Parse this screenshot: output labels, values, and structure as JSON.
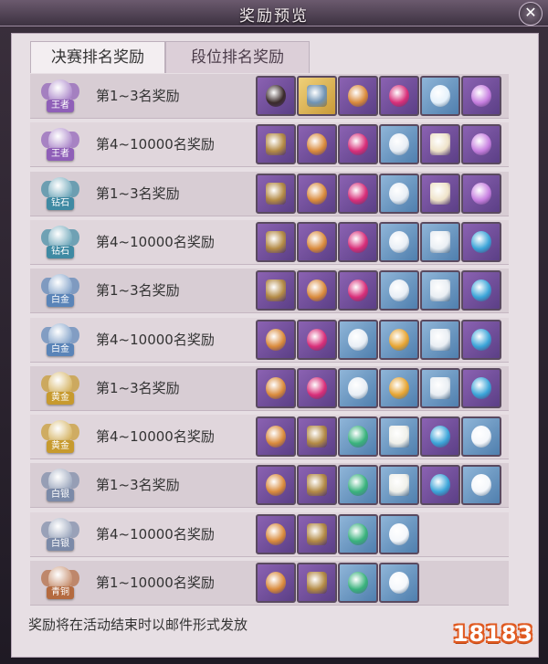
{
  "window": {
    "title": "奖励预览"
  },
  "tabs": [
    {
      "label": "决赛排名奖励",
      "active": true
    },
    {
      "label": "段位排名奖励",
      "active": false
    }
  ],
  "rows": [
    {
      "tier": "王者",
      "tier_color": "#8f5fb8",
      "label": "第1~3名奖励",
      "items": [
        "armor-portrait",
        "blue-chest",
        "gold-pouch",
        "pink-apple",
        "blue-crystal",
        "purple-mask"
      ]
    },
    {
      "tier": "王者",
      "tier_color": "#8f5fb8",
      "label": "第4~10000名奖励",
      "items": [
        "gold-chest",
        "gold-pouch",
        "pink-apple",
        "silver-crystal",
        "scroll",
        "purple-mask"
      ]
    },
    {
      "tier": "钻石",
      "tier_color": "#3f8aa3",
      "label": "第1~3名奖励",
      "items": [
        "gold-chest",
        "gold-pouch",
        "pink-apple",
        "silver-crystal",
        "scroll",
        "purple-mask"
      ]
    },
    {
      "tier": "钻石",
      "tier_color": "#3f8aa3",
      "label": "第4~10000名奖励",
      "items": [
        "gold-chest",
        "gold-pouch",
        "pink-apple",
        "silver-crystal",
        "blue-scroll",
        "blue-mask"
      ]
    },
    {
      "tier": "白金",
      "tier_color": "#5a84b8",
      "label": "第1~3名奖励",
      "items": [
        "gold-chest",
        "gold-pouch",
        "pink-apple",
        "silver-crystal",
        "blue-scroll",
        "blue-mask"
      ]
    },
    {
      "tier": "白金",
      "tier_color": "#5a84b8",
      "label": "第4~10000名奖励",
      "items": [
        "gold-pouch",
        "pink-apple",
        "silver-crystal",
        "gold-shard",
        "blue-scroll",
        "blue-mask"
      ]
    },
    {
      "tier": "黄金",
      "tier_color": "#c79a2e",
      "label": "第1~3名奖励",
      "items": [
        "gold-pouch",
        "pink-apple",
        "silver-crystal",
        "gold-shard",
        "blue-scroll",
        "blue-mask"
      ]
    },
    {
      "tier": "黄金",
      "tier_color": "#c79a2e",
      "label": "第4~10000名奖励",
      "items": [
        "gold-pouch",
        "gold-chest",
        "green-gem",
        "scroll-plain",
        "blue-mask",
        "white-crystal"
      ]
    },
    {
      "tier": "白银",
      "tier_color": "#7b8aa8",
      "label": "第1~3名奖励",
      "items": [
        "gold-pouch",
        "gold-chest",
        "green-gem",
        "scroll-plain",
        "blue-mask",
        "white-crystal"
      ]
    },
    {
      "tier": "白银",
      "tier_color": "#7b8aa8",
      "label": "第4~10000名奖励",
      "items": [
        "gold-pouch",
        "gold-chest",
        "green-gem",
        "white-crystal"
      ]
    },
    {
      "tier": "青铜",
      "tier_color": "#b46a3f",
      "label": "第1~10000名奖励",
      "items": [
        "gold-pouch",
        "gold-chest",
        "green-gem",
        "white-crystal"
      ]
    }
  ],
  "footer": {
    "text": "奖励将在活动结束时以邮件形式发放"
  },
  "watermark": {
    "text": "18183"
  },
  "item_styles": {
    "armor-portrait": {
      "frame": "r-purple",
      "color": "#3a2a2a"
    },
    "blue-chest": {
      "frame": "r-gold",
      "color": "#6f93b5"
    },
    "gold-pouch": {
      "frame": "r-purple",
      "color": "#d98a3b"
    },
    "pink-apple": {
      "frame": "r-purple",
      "color": "#d82e79"
    },
    "blue-crystal": {
      "frame": "r-blue",
      "color": "#e5f1fb"
    },
    "purple-mask": {
      "frame": "r-purple",
      "color": "#c77fe0"
    },
    "gold-chest": {
      "frame": "r-purple",
      "color": "#b38a45"
    },
    "silver-crystal": {
      "frame": "r-blue",
      "color": "#e8eef5"
    },
    "scroll": {
      "frame": "r-purple",
      "color": "#efe3c9"
    },
    "blue-scroll": {
      "frame": "r-blue",
      "color": "#e9eef3"
    },
    "blue-mask": {
      "frame": "r-purple",
      "color": "#3aa4d8"
    },
    "gold-shard": {
      "frame": "r-blue",
      "color": "#e6a431"
    },
    "green-gem": {
      "frame": "r-blue",
      "color": "#39b27c"
    },
    "scroll-plain": {
      "frame": "r-blue",
      "color": "#f0f0ea"
    },
    "white-crystal": {
      "frame": "r-blue",
      "color": "#f4f7fb"
    }
  }
}
